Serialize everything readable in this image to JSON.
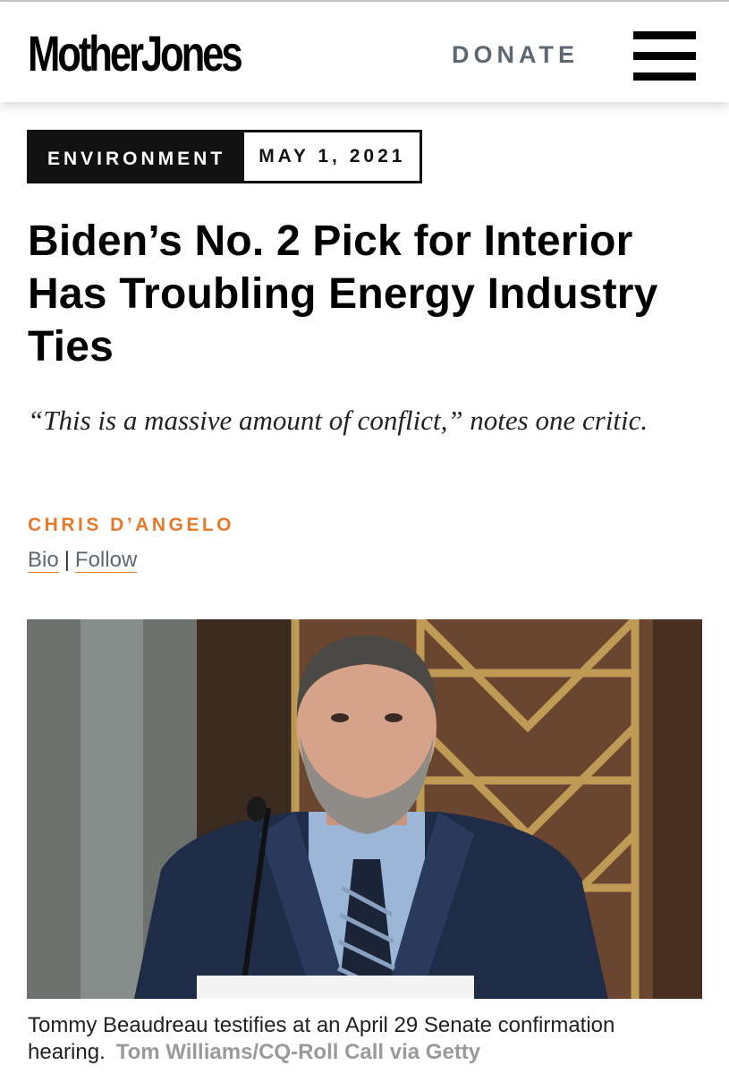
{
  "header": {
    "logo_text": "MotherJones",
    "donate_label": "DONATE",
    "menu_icon": "hamburger-icon"
  },
  "article": {
    "category": "ENVIRONMENT",
    "date": "MAY 1, 2021",
    "headline": "Biden’s No. 2 Pick for Interior Has Troubling Energy Industry Ties",
    "dek": "“This is a massive amount of conflict,” notes one critic.",
    "author": "CHRIS D’ANGELO",
    "bio_label": "Bio",
    "separator": "|",
    "follow_label": "Follow",
    "photo": {
      "caption": "Tommy Beaudreau testifies at an April 29 Senate confirmation hearing.",
      "credit": "Tom Williams/CQ-Roll Call via Getty"
    }
  },
  "colors": {
    "accent_orange": "#e8792b",
    "donate_gray": "#5d6870",
    "category_bg": "#111111"
  }
}
